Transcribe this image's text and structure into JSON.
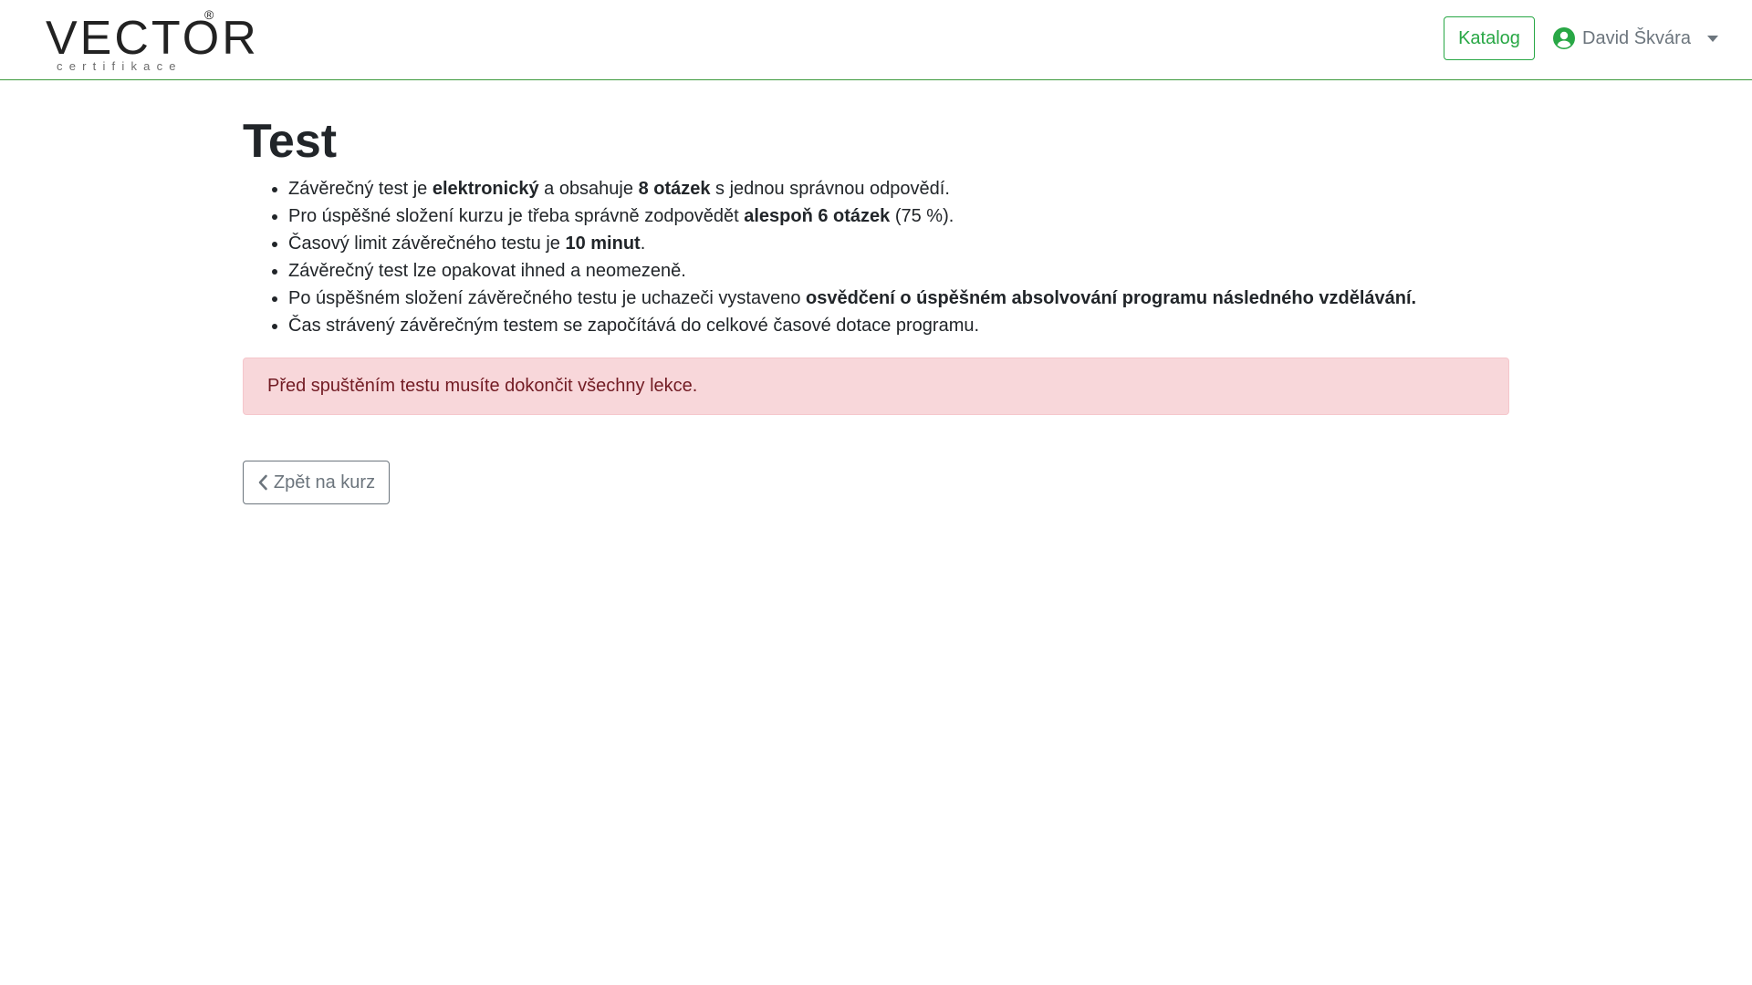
{
  "header": {
    "logo_text": "VECTOR",
    "logo_reg": "®",
    "logo_sub": "certifikace",
    "katalog_label": "Katalog",
    "user_name": "David Škvára",
    "user_icon": "user-circle-icon",
    "caret_icon": "caret-down-icon"
  },
  "main": {
    "title": "Test",
    "rules": [
      {
        "a": "Závěrečný test je ",
        "b": "elektronický",
        "c": " a obsahuje ",
        "d": "8 otázek",
        "e": " s jednou správnou odpovědí."
      },
      {
        "a": "Pro úspěšné složení kurzu je třeba správně zodpovědět ",
        "b": "alespoň 6 otázek",
        "c": " (75 %)."
      },
      {
        "a": "Časový limit závěrečného testu je ",
        "b": "10 minut",
        "c": "."
      },
      {
        "a": "Závěrečný test lze opakovat ihned a neomezeně."
      },
      {
        "a": "Po úspěšném složení závěrečného testu je uchazeči vystaveno ",
        "b": "osvědčení o úspěšném absolvování programu následného vzdělávání."
      },
      {
        "a": "Čas strávený závěrečným testem se započítává do celkové časové dotace programu."
      }
    ],
    "alert_text": "Před spuštěním testu musíte dokončit všechny lekce.",
    "back_label": "Zpět na kurz",
    "back_icon": "chevron-left-icon"
  },
  "colors": {
    "accent": "#28a745",
    "alert_bg": "#f8d7da",
    "alert_text": "#721c24",
    "muted": "#6c757d"
  }
}
